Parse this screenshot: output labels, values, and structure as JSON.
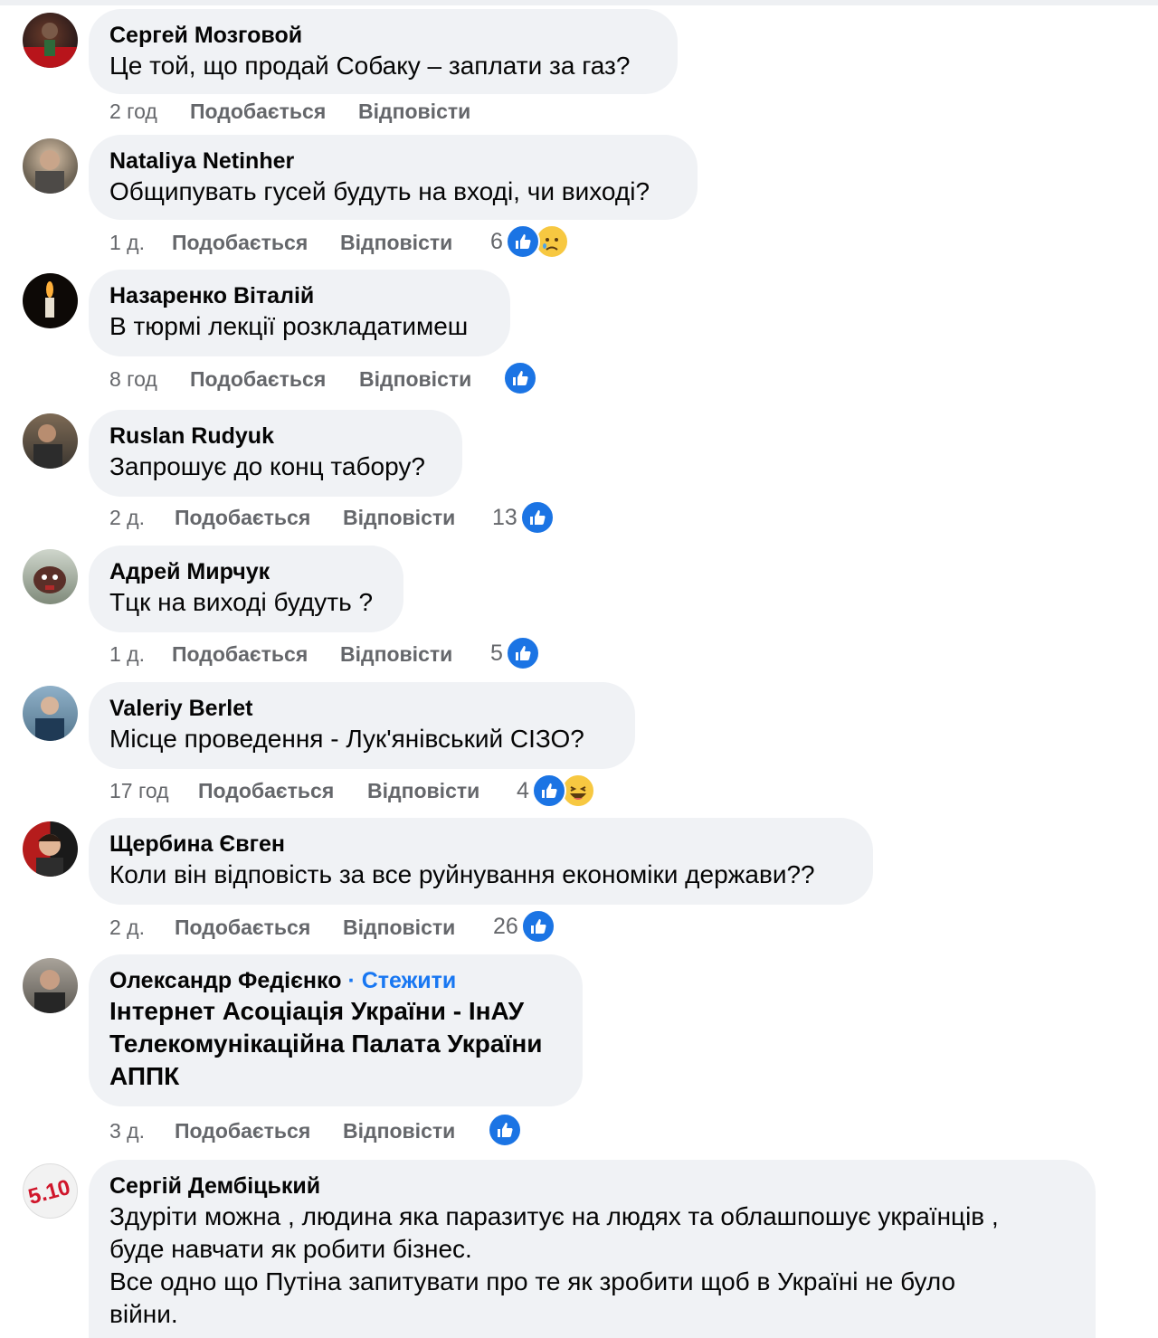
{
  "comments": [
    {
      "author": "Сергей Мозговой",
      "text": "Це той, що продай Собаку – заплати за газ?",
      "time": "2 год",
      "like": "Подобається",
      "reply": "Відповісти",
      "reaction_count": "",
      "reactions": []
    },
    {
      "author": "Nataliya Netinher",
      "text": "Общипувать гусей будуть на вході, чи виході?",
      "time": "1 д.",
      "like": "Подобається",
      "reply": "Відповісти",
      "reaction_count": "6",
      "reactions": [
        "like-icon",
        "sad-icon"
      ]
    },
    {
      "author": "Назаренко Віталій",
      "text": "В тюрмі лекції розкладатимеш",
      "time": "8 год",
      "like": "Подобається",
      "reply": "Відповісти",
      "reaction_count": "",
      "reactions": [
        "like-icon"
      ]
    },
    {
      "author": "Ruslan Rudyuk",
      "text": "Запрошує до конц табору?",
      "time": "2 д.",
      "like": "Подобається",
      "reply": "Відповісти",
      "reaction_count": "13",
      "reactions": [
        "like-icon"
      ]
    },
    {
      "author": "Адрей Мирчук",
      "text": "Тцк на виході будуть ?",
      "time": "1 д.",
      "like": "Подобається",
      "reply": "Відповісти",
      "reaction_count": "5",
      "reactions": [
        "like-icon"
      ]
    },
    {
      "author": "Valeriy Berlet",
      "text": "Місце проведення - Лук'янівський СІЗО?",
      "time": "17 год",
      "like": "Подобається",
      "reply": "Відповісти",
      "reaction_count": "4",
      "reactions": [
        "like-icon",
        "haha-icon"
      ]
    },
    {
      "author": "Щербина Євген",
      "text": "Коли він відповість за все руйнування економіки держави??",
      "time": "2 д.",
      "like": "Подобається",
      "reply": "Відповісти",
      "reaction_count": "26",
      "reactions": [
        "like-icon"
      ]
    },
    {
      "author": "Олександр Федієнко",
      "follow": "· Стежити",
      "lines": [
        "Інтернет Асоціація України - ІнАУ",
        "Телекомунікаційна Палата України",
        "АППК"
      ],
      "time": "3 д.",
      "like": "Подобається",
      "reply": "Відповісти",
      "reaction_count": "",
      "reactions": [
        "like-icon"
      ]
    },
    {
      "author": "Сергій Дембіцький",
      "lines": [
        "Здуріти можна , людина яка паразитує на людях та облашпошує українців ,",
        "буде навчати як робити бізнес.",
        "Все одно що Путіна запитувати про те як зробити щоб в Україні не було",
        "війни."
      ]
    }
  ],
  "colors": {
    "bubble": "#f0f2f5",
    "like": "#1b74e4",
    "follow": "#1877f2",
    "meta": "#65676b"
  }
}
